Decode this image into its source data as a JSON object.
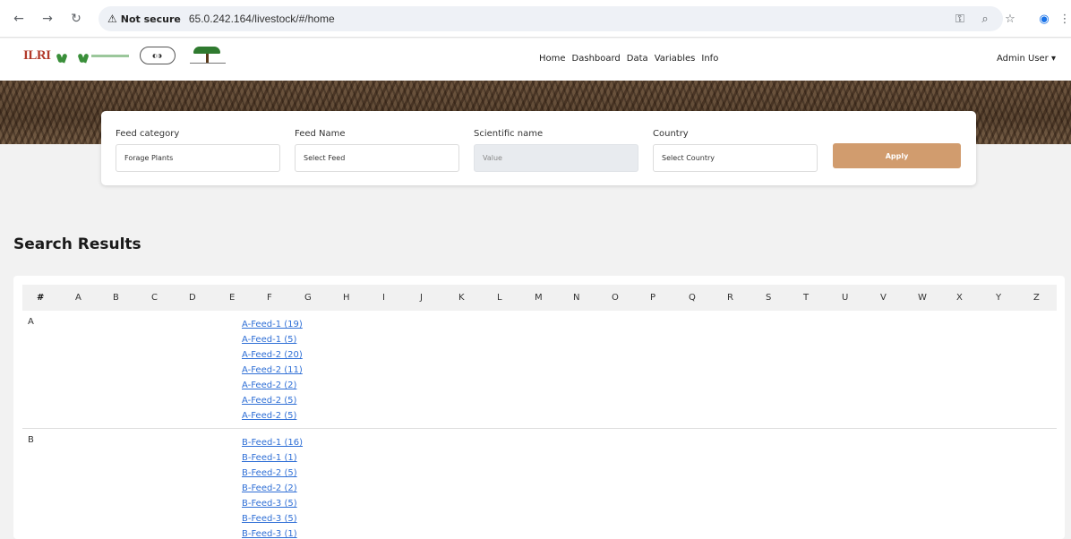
{
  "browser": {
    "security_label": "Not secure",
    "url": "65.0.242.164/livestock/#/home"
  },
  "header": {
    "logo_text": "ILRI",
    "menu": [
      "Home",
      "Dashboard",
      "Data",
      "Variables",
      "Info"
    ],
    "user_menu": "Admin User ▾"
  },
  "filters": {
    "feed_category": {
      "label": "Feed category",
      "value": "Forage Plants"
    },
    "feed_name": {
      "label": "Feed Name",
      "value": "Select Feed"
    },
    "scientific_name": {
      "label": "Scientific name",
      "placeholder": "Value"
    },
    "country": {
      "label": "Country",
      "value": "Select Country"
    },
    "apply_label": "Apply"
  },
  "results": {
    "title": "Search Results",
    "alphabet": [
      "#",
      "A",
      "B",
      "C",
      "D",
      "E",
      "F",
      "G",
      "H",
      "I",
      "J",
      "K",
      "L",
      "M",
      "N",
      "O",
      "P",
      "Q",
      "R",
      "S",
      "T",
      "U",
      "V",
      "W",
      "X",
      "Y",
      "Z"
    ],
    "groups": [
      {
        "letter": "A",
        "feeds": [
          "A-Feed-1 (19)",
          "A-Feed-1 (5)",
          "A-Feed-2 (20)",
          "A-Feed-2 (11)",
          "A-Feed-2 (2)",
          "A-Feed-2 (5)",
          "A-Feed-2 (5)"
        ]
      },
      {
        "letter": "B",
        "feeds": [
          "B-Feed-1 (16)",
          "B-Feed-1 (1)",
          "B-Feed-2 (5)",
          "B-Feed-2 (2)",
          "B-Feed-3 (5)",
          "B-Feed-3 (5)",
          "B-Feed-3 (1)"
        ]
      }
    ]
  }
}
